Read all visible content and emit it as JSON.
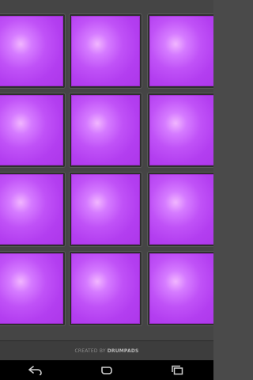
{
  "pads": {
    "color": "#b43ff0",
    "count": 12,
    "rows": 4,
    "columns": 3
  },
  "footer": {
    "prefix": "CREATED BY",
    "brand": "DRUMPADS"
  },
  "navbar": {
    "buttons": [
      {
        "name": "back-icon"
      },
      {
        "name": "home-icon"
      },
      {
        "name": "recent-apps-icon"
      }
    ]
  }
}
